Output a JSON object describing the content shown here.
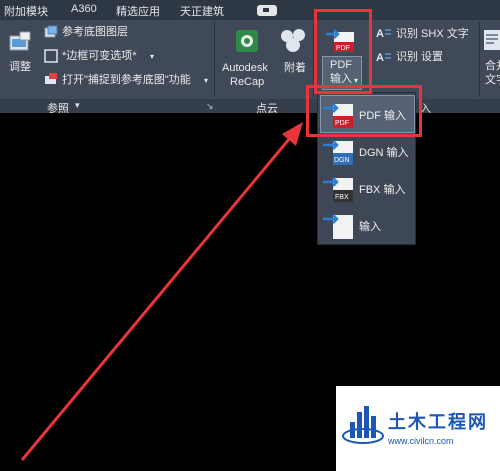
{
  "tabs": [
    "附加模块",
    "A360",
    "精选应用",
    "天正建筑"
  ],
  "reference": {
    "adjust_label": "调整",
    "underlay_layers": "参考底图图层",
    "frame_variable": "*边框可变选项*",
    "snap_underlay": "打开\"捕捉到参考底图\"功能",
    "panel_title": "参照"
  },
  "point_cloud": {
    "recap_label_1": "Autodesk",
    "recap_label_2": "ReCap",
    "attach_label": "附着",
    "panel_title": "点云"
  },
  "import": {
    "pdf_label_1": "PDF",
    "pdf_label_2": "输入",
    "recognize_shx": "识别 SHX 文字",
    "recognize_settings": "识别 设置",
    "panel_tail": "入"
  },
  "merge": {
    "label_1": "合并",
    "label_2": "文字"
  },
  "dropdown": {
    "items": [
      {
        "label": "PDF 输入",
        "icon": "pdf-import-icon"
      },
      {
        "label": "DGN 输入",
        "icon": "dgn-import-icon"
      },
      {
        "label": "FBX 输入",
        "icon": "fbx-import-icon"
      },
      {
        "label": "输入",
        "icon": "generic-import-icon"
      }
    ]
  },
  "watermark": {
    "title": "土木工程网",
    "url": "www.civilcn.com"
  },
  "colors": {
    "ribbon": "#3f4957",
    "tabbar": "#2e3744",
    "highlight": "#e8343b",
    "arrow_blue": "#2a7fd4",
    "pdf_red": "#c8202b"
  }
}
